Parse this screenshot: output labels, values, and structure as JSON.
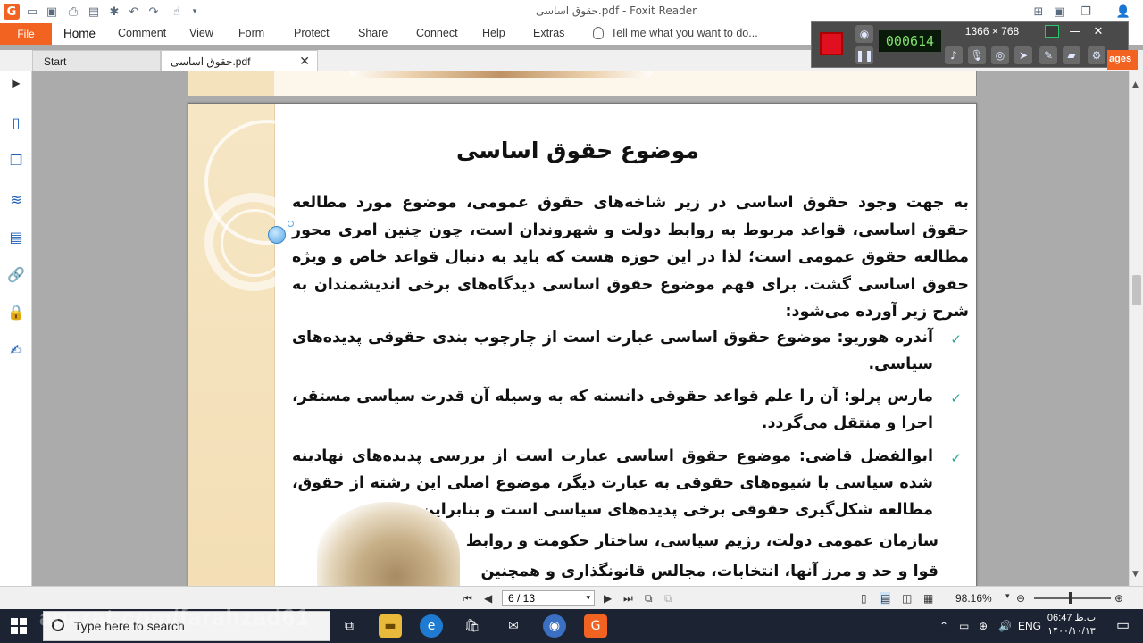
{
  "window": {
    "title": "حقوق اساسی.pdf - Foxit Reader"
  },
  "ribbon": {
    "file": "File",
    "tabs": [
      "Home",
      "Comment",
      "View",
      "Form",
      "Protect",
      "Share",
      "Connect",
      "Help",
      "Extras"
    ],
    "tell_me": "Tell me what you want to do..."
  },
  "doc_tabs": {
    "start": "Start",
    "current": "حقوق اساسی.pdf"
  },
  "recorder": {
    "resolution": "1366 × 768",
    "timer": "000614",
    "side_label": "ages"
  },
  "document": {
    "title": "موضوع حقوق اساسی",
    "intro": "به جهت وجود حقوق اساسی در زیر شاخه‌های حقوق عمومی، موضوع مورد مطالعه حقوق اساسی، قواعد مربوط به روابط دولت و شهروندان است، چون چنین امری محور مطالعه حقوق عمومی است؛ لذا در این حوزه هست که باید به دنبال قواعد خاص و ویژه حقوق اساسی گشت. برای فهم موضوع حقوق اساسی دیدگاه‌های برخی اندیشمندان به شرح زیر آورده می‌شود:",
    "bullets": [
      "آندره هوریو: موضوع حقوق اساسی عبارت است از چارچوب بندی حقوقی پدیده‌های سیاسی.",
      "مارس پرلو: آن را علم قواعد حقوقی دانسته که به وسیله آن قدرت سیاسی مستقر، اجرا و منتقل می‌گردد.",
      "ابوالفضل قاضی: موضوع حقوق اساسی عبارت است از بررسی پدیده‌های نهادینه شده سیاسی با شیوه‌های حقوقی به عبارت دیگر، موضوع اصلی این رشته از حقوق، مطالعه شکل‌گیری حقوقی برخی پدیده‌های سیاسی است و بنابراین"
    ],
    "tail_lines": [
      "سازمان عمومی دولت، رژیم سیاسی، ساختار حکومت و روابط",
      "قوا و حد و مرز آنها، انتخابات، مجالس قانونگذاری و همچنین"
    ]
  },
  "status": {
    "page": "6 / 13",
    "zoom": "98.16%"
  },
  "taskbar": {
    "search_placeholder": "Type here to search",
    "lang": "ENG",
    "time": "06:47 ب.ظ",
    "date": "۱۴۰۰/۱۰/۱۳",
    "watermark": "aparat.com/farahzad61"
  }
}
